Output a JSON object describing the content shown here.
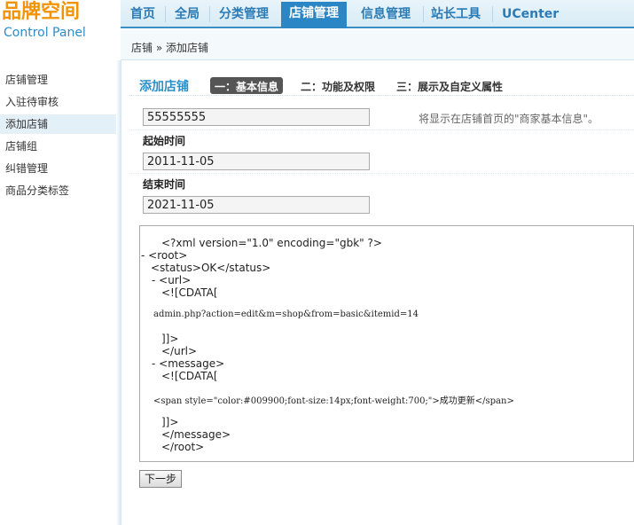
{
  "logo": {
    "title": "品牌空间",
    "subtitle": "Control Panel"
  },
  "nav": {
    "items": [
      "首页",
      "全局",
      "分类管理",
      "店铺管理",
      "信息管理",
      "站长工具",
      "UCenter"
    ],
    "active_index": 3
  },
  "breadcrumb": "店铺 » 添加店铺",
  "sidebar": {
    "items": [
      "店铺管理",
      "入驻待审核",
      "添加店铺",
      "店铺组",
      "纠错管理",
      "商品分类标签"
    ],
    "active_index": 2
  },
  "main": {
    "title": "添加店铺",
    "steps": [
      "一：基本信息",
      "二：功能及权限",
      "三：展示及自定义属性"
    ],
    "active_step": 0,
    "shop_name_value": "55555555",
    "shop_name_hint": "将显示在店铺首页的\"商家基本信息\"。",
    "start_label": "起始时间",
    "start_value": "2011-11-05",
    "end_label": "结束时间",
    "end_value": "2021-11-05",
    "xml_lines": [
      "<?xml version=\"1.0\" encoding=\"gbk\" ?>",
      "- <root>",
      "<status>OK</status>",
      "- <url>",
      "<![CDATA[",
      "admin.php?action=edit&m=shop&from=basic&itemid=14",
      "]]>",
      "</url>",
      "- <message>",
      "<![CDATA[",
      "<span style=\"color:#009900;font-size:14px;font-weight:700;\">成功更新</span>",
      "]]>",
      "</message>",
      "</root>"
    ],
    "next_label": "下一步"
  },
  "colors": {
    "accent": "#2b86c5",
    "logo_orange": "#f29306"
  }
}
